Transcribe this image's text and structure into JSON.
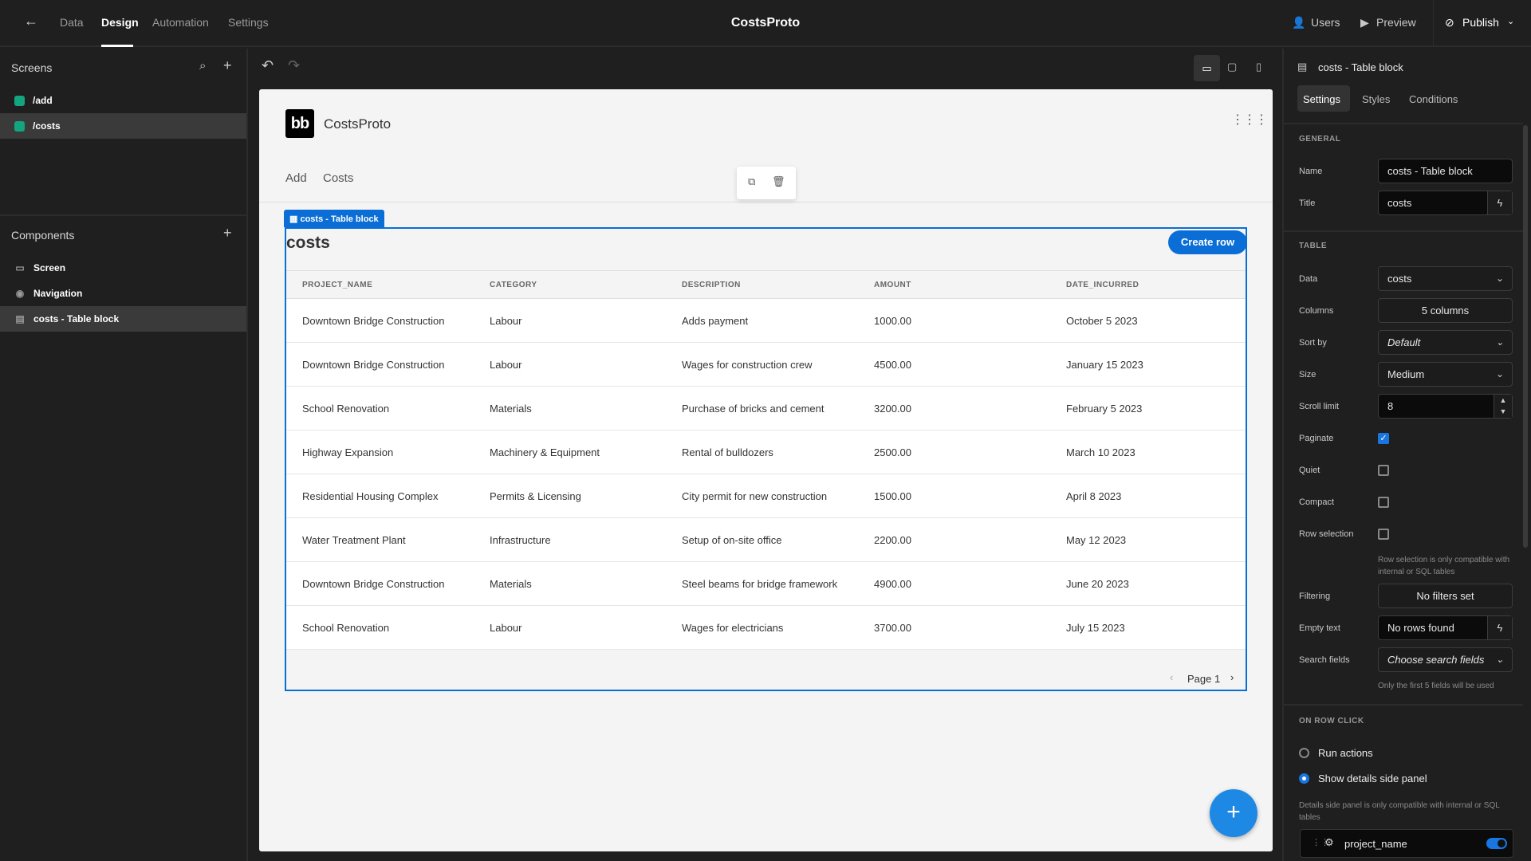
{
  "topbar": {
    "nav": [
      "Data",
      "Design",
      "Automation",
      "Settings"
    ],
    "active": "Design",
    "app_title": "CostsProto",
    "users": "Users",
    "preview": "Preview",
    "publish": "Publish"
  },
  "screens": {
    "title": "Screens",
    "items": [
      "/add",
      "/costs"
    ],
    "selected": "/costs",
    "color": "#12a57f"
  },
  "components": {
    "title": "Components",
    "items": [
      {
        "label": "Screen",
        "icon": "screen-icon"
      },
      {
        "label": "Navigation",
        "icon": "eye-icon"
      },
      {
        "label": "costs - Table block",
        "icon": "table-icon"
      }
    ],
    "selected": "costs - Table block"
  },
  "app": {
    "logo": "bb",
    "title": "CostsProto",
    "nav": [
      "Add",
      "Costs"
    ]
  },
  "table": {
    "tag": "costs - Table block",
    "title": "costs",
    "create_label": "Create row",
    "columns": [
      "PROJECT_NAME",
      "CATEGORY",
      "DESCRIPTION",
      "AMOUNT",
      "DATE_INCURRED"
    ],
    "rows": [
      [
        "Downtown Bridge Construction",
        "Labour",
        "Adds payment",
        "1000.00",
        "October 5 2023"
      ],
      [
        "Downtown Bridge Construction",
        "Labour",
        "Wages for construction crew",
        "4500.00",
        "January 15 2023"
      ],
      [
        "School Renovation",
        "Materials",
        "Purchase of bricks and cement",
        "3200.00",
        "February 5 2023"
      ],
      [
        "Highway Expansion",
        "Machinery & Equipment",
        "Rental of bulldozers",
        "2500.00",
        "March 10 2023"
      ],
      [
        "Residential Housing Complex",
        "Permits & Licensing",
        "City permit for new construction",
        "1500.00",
        "April 8 2023"
      ],
      [
        "Water Treatment Plant",
        "Infrastructure",
        "Setup of on-site office",
        "2200.00",
        "May 12 2023"
      ],
      [
        "Downtown Bridge Construction",
        "Materials",
        "Steel beams for bridge framework",
        "4900.00",
        "June 20 2023"
      ],
      [
        "School Renovation",
        "Labour",
        "Wages for electricians",
        "3700.00",
        "July 15 2023"
      ]
    ],
    "page": "Page 1"
  },
  "panel": {
    "title": "costs - Table block",
    "tabs": [
      "Settings",
      "Styles",
      "Conditions"
    ],
    "active_tab": "Settings",
    "general": "GENERAL",
    "name_label": "Name",
    "name_value": "costs - Table block",
    "title_label": "Title",
    "title_value": "costs",
    "table_section": "TABLE",
    "data_label": "Data",
    "data_value": "costs",
    "columns_label": "Columns",
    "columns_value": "5 columns",
    "sort_label": "Sort by",
    "sort_value": "Default",
    "size_label": "Size",
    "size_value": "Medium",
    "scroll_label": "Scroll limit",
    "scroll_value": "8",
    "paginate_label": "Paginate",
    "paginate": true,
    "quiet_label": "Quiet",
    "quiet": false,
    "compact_label": "Compact",
    "compact": false,
    "rowsel_label": "Row selection",
    "rowsel": false,
    "rowsel_hint": "Row selection is only compatible with internal or SQL tables",
    "filter_label": "Filtering",
    "filter_value": "No filters set",
    "empty_label": "Empty text",
    "empty_value": "No rows found",
    "search_label": "Search fields",
    "search_placeholder": "Choose search fields",
    "search_hint": "Only the first 5 fields will be used",
    "onrow": "ON ROW CLICK",
    "run_actions": "Run actions",
    "show_details": "Show details side panel",
    "selected_option": "Show details side panel",
    "details_hint": "Details side panel is only compatible with internal or SQL tables",
    "field": "project_name",
    "field_enabled": true
  },
  "colors": {
    "accent": "#0a6ed6",
    "check": "#1976e0"
  }
}
